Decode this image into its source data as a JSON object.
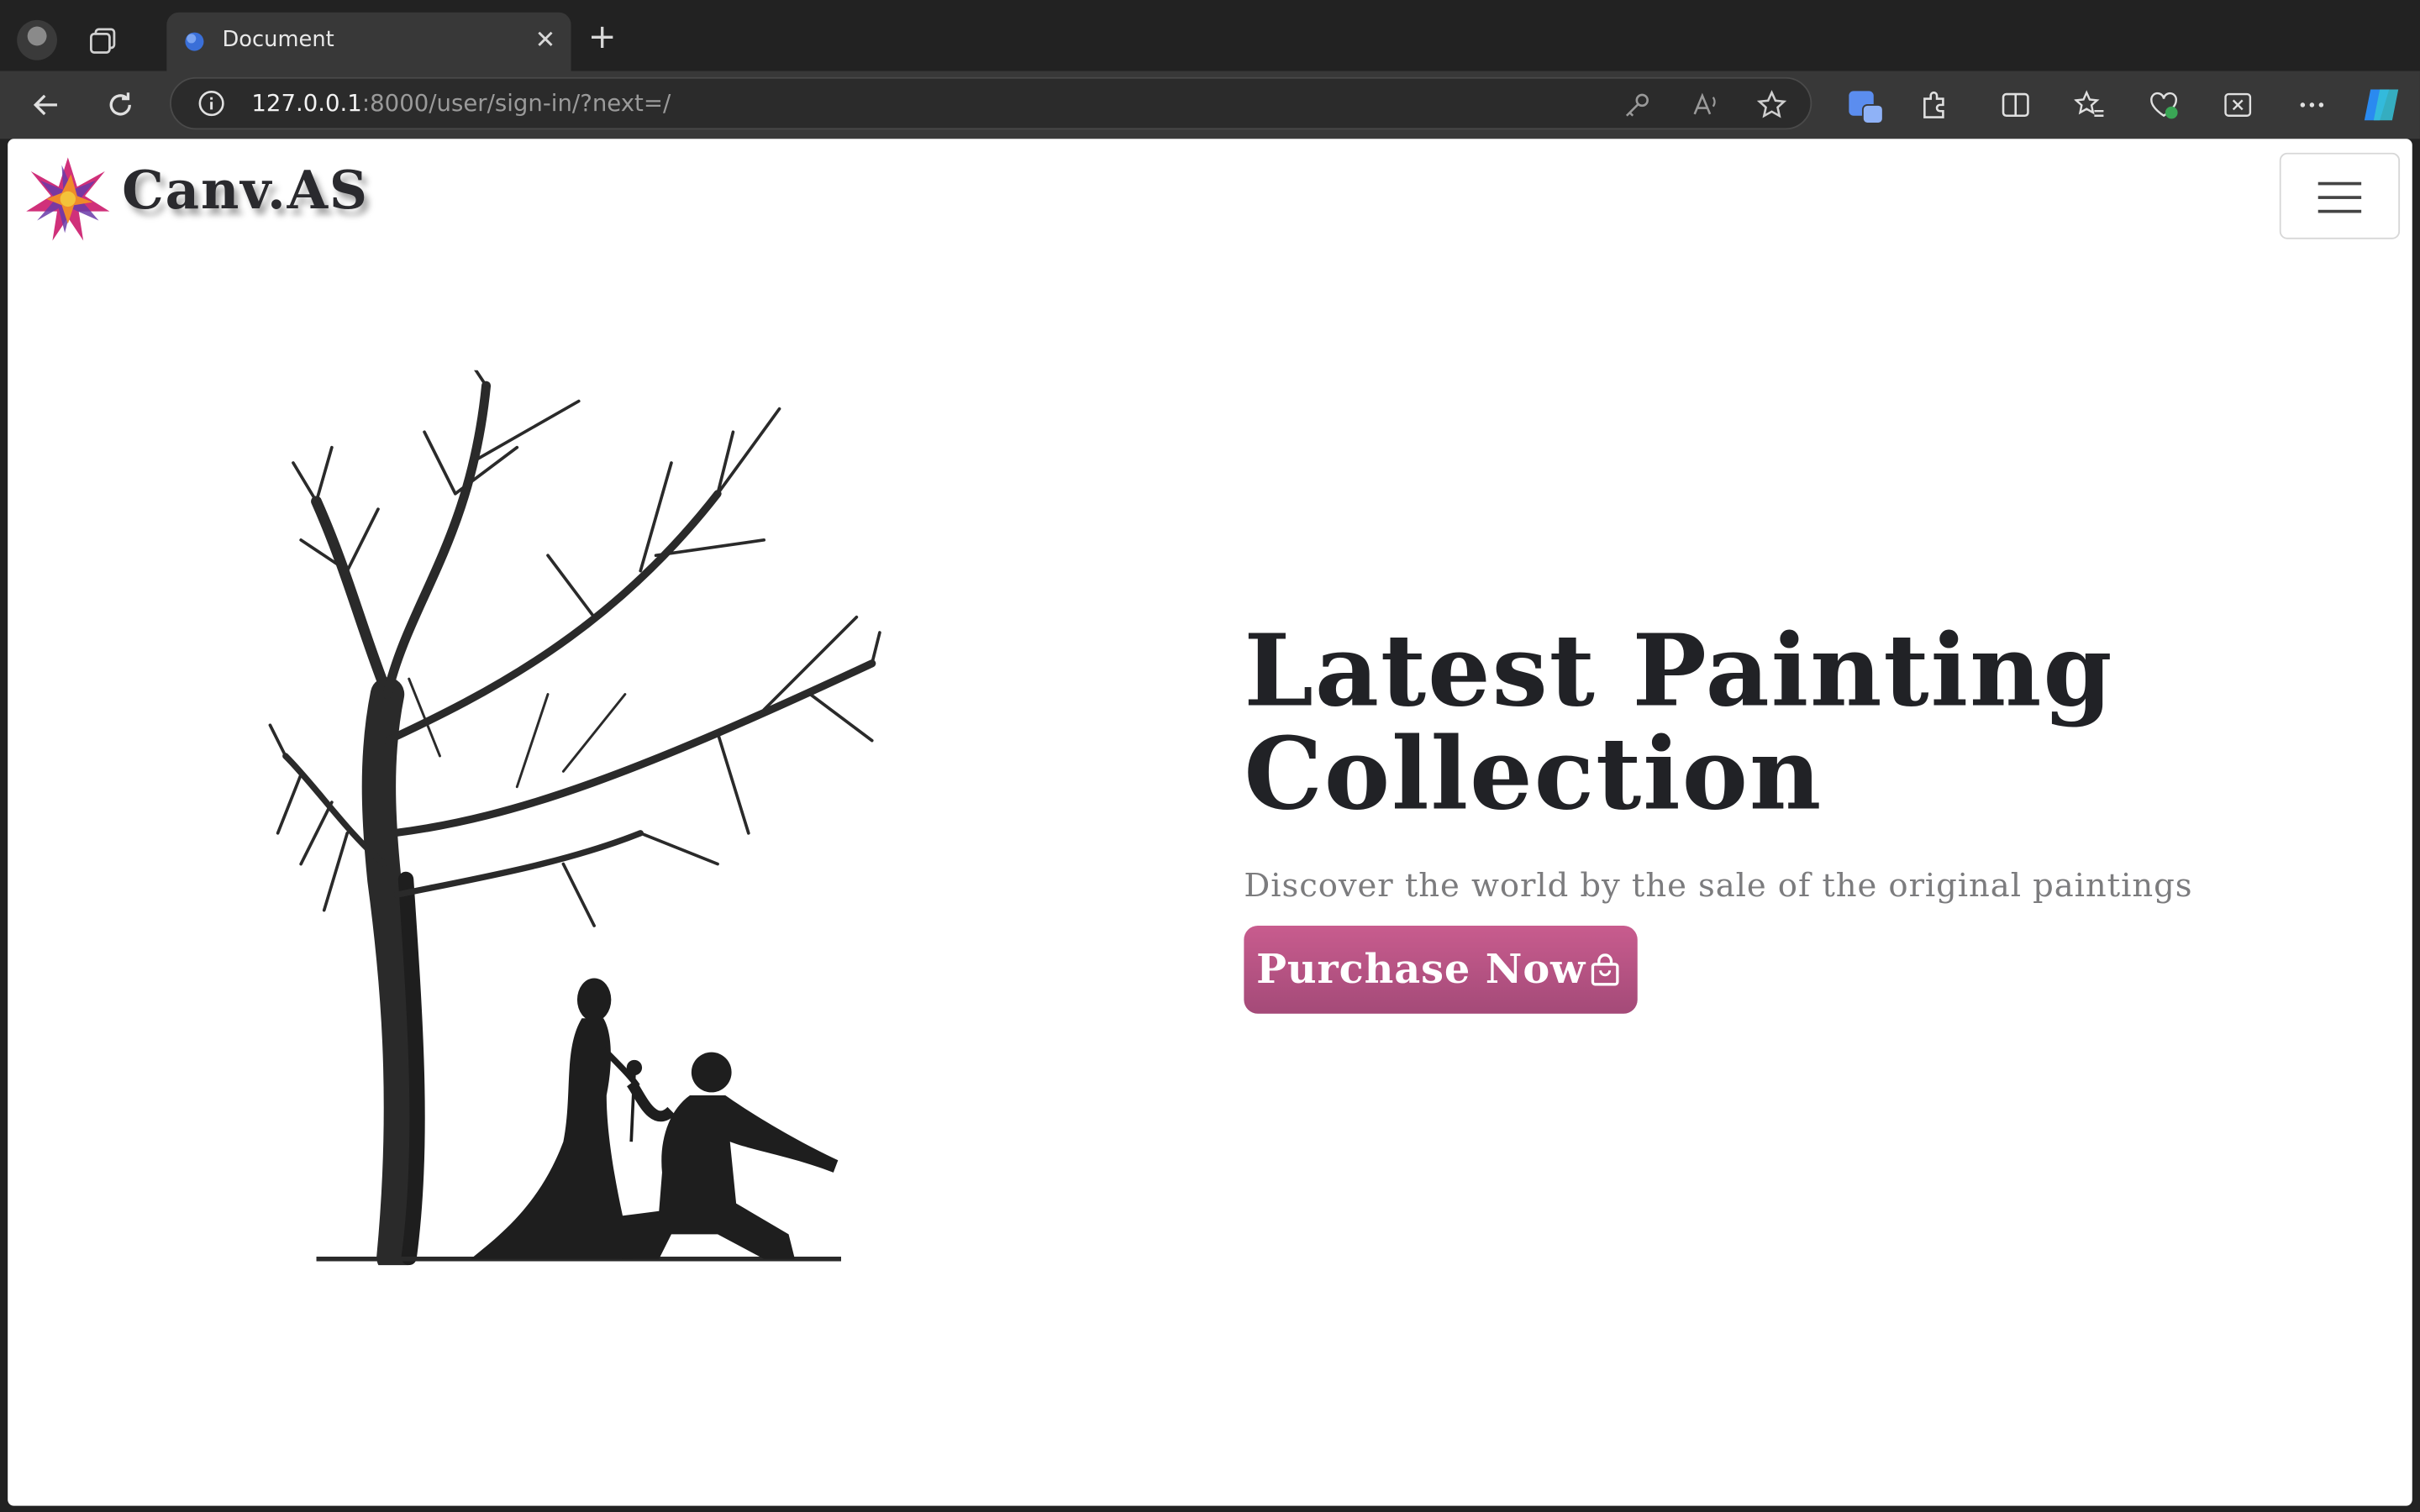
{
  "browser": {
    "tab_title": "Document",
    "tab_close": "✕",
    "new_tab": "+",
    "url_host": "127.0.0.1",
    "url_rest": ":8000/user/sign-in/?next=/"
  },
  "navbar": {
    "brand_name": "Canv.AS"
  },
  "hero": {
    "title_line1": "Latest Painting",
    "title_line2": "Collection",
    "subtitle": "Discover the world by the sale of the original paintings",
    "button_label": "Purchase Now"
  },
  "colors": {
    "button": "#b9557f",
    "title": "#212226",
    "subtitle": "#7c7c7e"
  }
}
